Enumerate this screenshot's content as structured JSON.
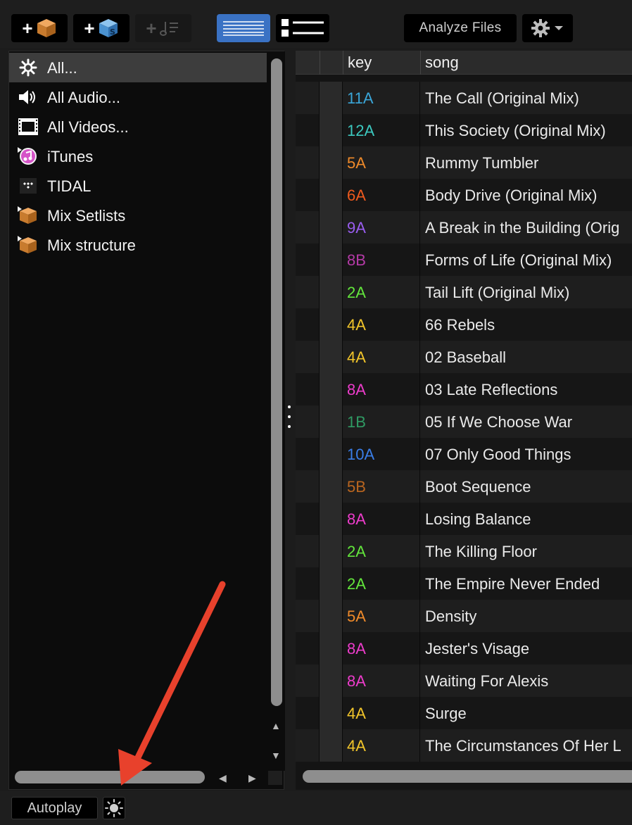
{
  "toolbar": {
    "analyze_label": "Analyze Files",
    "icons": [
      "add-crate-icon",
      "add-smart-crate-icon",
      "add-playlist-icon",
      "list-view-icon",
      "detail-list-view-icon",
      "gear-icon"
    ]
  },
  "sidebar": {
    "items": [
      {
        "label": "All...",
        "icon": "all-asterisk-icon",
        "selected": true
      },
      {
        "label": "All Audio...",
        "icon": "speaker-icon"
      },
      {
        "label": "All Videos...",
        "icon": "film-icon"
      },
      {
        "label": "iTunes",
        "icon": "itunes-icon"
      },
      {
        "label": "TIDAL",
        "icon": "tidal-icon"
      },
      {
        "label": "Mix Setlists",
        "icon": "crate-icon"
      },
      {
        "label": "Mix structure",
        "icon": "crate-icon"
      }
    ]
  },
  "table": {
    "headers": {
      "key": "key",
      "song": "song"
    },
    "rows": [
      {
        "key": "11A",
        "song": "The Call (Original Mix)",
        "color": "#3aa6d8"
      },
      {
        "key": "12A",
        "song": "This Society (Original Mix)",
        "color": "#3cc9c0"
      },
      {
        "key": "5A",
        "song": "Rummy Tumbler",
        "color": "#ef8a2a"
      },
      {
        "key": "6A",
        "song": "Body Drive (Original Mix)",
        "color": "#ee5a1e"
      },
      {
        "key": "9A",
        "song": "A Break in the Building (Orig",
        "color": "#9a5df0"
      },
      {
        "key": "8B",
        "song": "Forms of Life (Original Mix)",
        "color": "#b43aa6"
      },
      {
        "key": "2A",
        "song": "Tail Lift (Original Mix)",
        "color": "#63e63c"
      },
      {
        "key": "4A",
        "song": "66 Rebels",
        "color": "#f2c52a"
      },
      {
        "key": "4A",
        "song": "02 Baseball",
        "color": "#f2c52a"
      },
      {
        "key": "8A",
        "song": "03 Late Reflections",
        "color": "#ee3ccc"
      },
      {
        "key": "1B",
        "song": "05 If We Choose War",
        "color": "#2f9a63"
      },
      {
        "key": "10A",
        "song": "07 Only Good Things",
        "color": "#3a7ee8"
      },
      {
        "key": "5B",
        "song": "Boot Sequence",
        "color": "#b9651f"
      },
      {
        "key": "8A",
        "song": "Losing Balance",
        "color": "#ee3ccc"
      },
      {
        "key": "2A",
        "song": "The Killing Floor",
        "color": "#63e63c"
      },
      {
        "key": "2A",
        "song": "The Empire Never Ended",
        "color": "#63e63c"
      },
      {
        "key": "5A",
        "song": "Density",
        "color": "#ef8a2a"
      },
      {
        "key": "8A",
        "song": "Jester's Visage",
        "color": "#ee3ccc"
      },
      {
        "key": "8A",
        "song": "Waiting For Alexis",
        "color": "#ee3ccc"
      },
      {
        "key": "4A",
        "song": "Surge",
        "color": "#f2c52a"
      },
      {
        "key": "4A",
        "song": "The Circumstances Of Her L",
        "color": "#f2c52a"
      }
    ]
  },
  "bottom": {
    "autoplay_label": "Autoplay",
    "icons": [
      "automix-sun-icon"
    ]
  },
  "annotation": {
    "color": "#e8412c"
  }
}
